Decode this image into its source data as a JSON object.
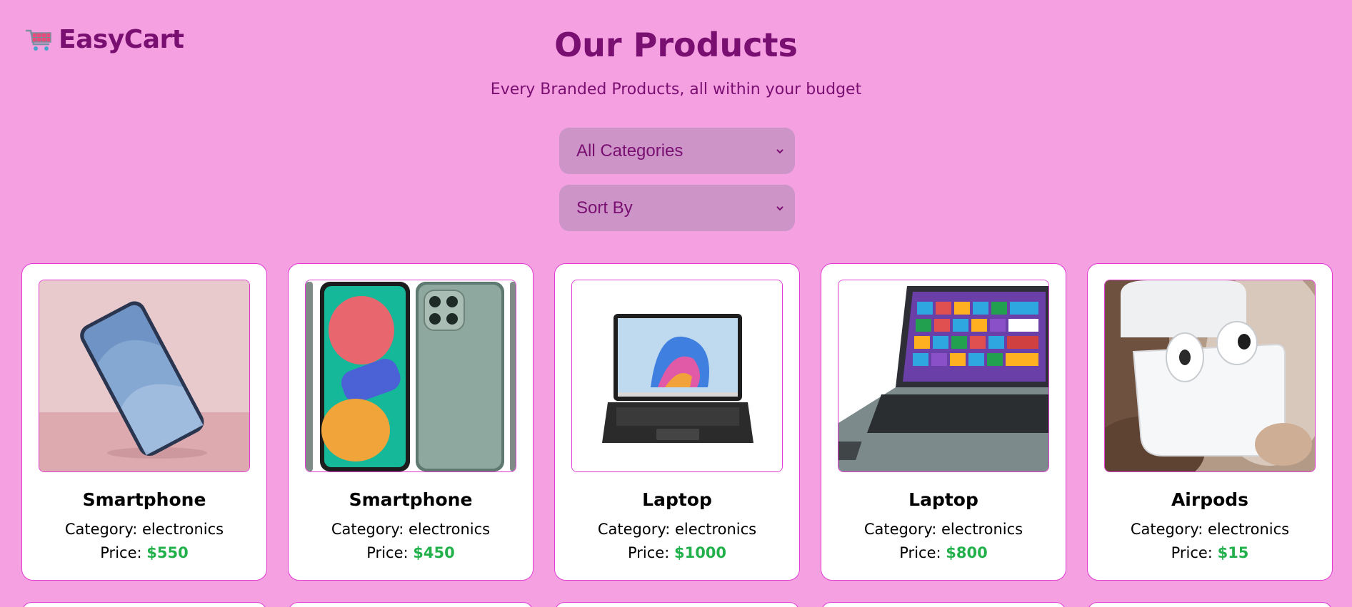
{
  "brand": {
    "name": "EasyCart",
    "icon": "shopping-cart-icon"
  },
  "header": {
    "title": "Our Products",
    "subtitle": "Every Branded Products, all within your budget"
  },
  "filters": {
    "category": {
      "selected": "All Categories"
    },
    "sort": {
      "selected": "Sort By"
    }
  },
  "products": [
    {
      "name": "Smartphone",
      "category": "Category: electronics",
      "price_label": "Price:",
      "price": "$550",
      "image": "smartphone-photo"
    },
    {
      "name": "Smartphone",
      "category": "Category: electronics",
      "price_label": "Price:",
      "price": "$450",
      "image": "samsung-phone-photo"
    },
    {
      "name": "Laptop",
      "category": "Category: electronics",
      "price_label": "Price:",
      "price": "$1000",
      "image": "laptop-photo"
    },
    {
      "name": "Laptop",
      "category": "Category: electronics",
      "price_label": "Price:",
      "price": "$800",
      "image": "acer-laptop-photo"
    },
    {
      "name": "Airpods",
      "category": "Category: electronics",
      "price_label": "Price:",
      "price": "$15",
      "image": "airpods-photo"
    }
  ],
  "colors": {
    "background": "#f5a0e1",
    "accent": "#7a0f72",
    "select_bg": "#cc94c7",
    "card_border": "#e23bd4",
    "price": "#22b04b"
  }
}
